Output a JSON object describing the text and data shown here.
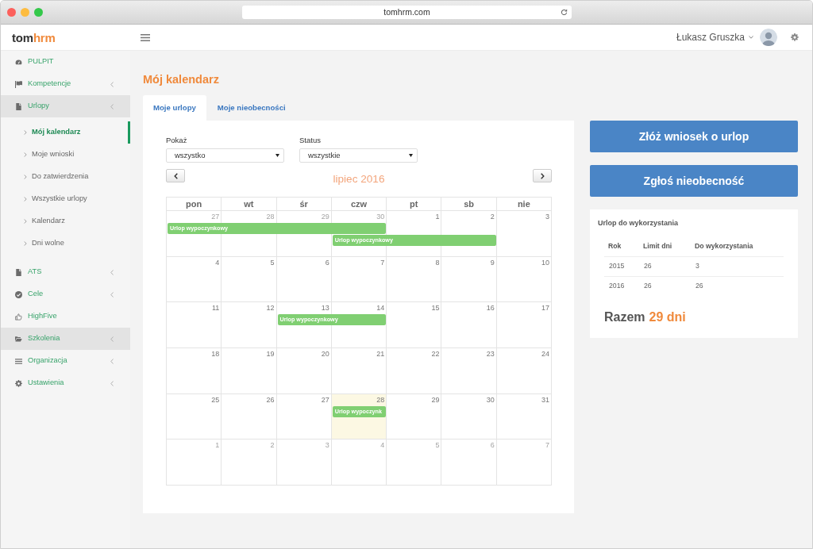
{
  "browser": {
    "url": "tomhrm.com"
  },
  "header": {
    "logo": {
      "part_1": "tom",
      "part_2": "hrm"
    },
    "user_name": "Łukasz Gruszka"
  },
  "sidebar": {
    "items": [
      {
        "label": "PULPIT",
        "kind": "link",
        "highlighted": false
      },
      {
        "label": "Kompetencje",
        "kind": "group",
        "highlighted": false
      },
      {
        "label": "Urlopy",
        "kind": "group",
        "highlighted": true,
        "children": [
          {
            "label": "Mój kalendarz",
            "selected": true
          },
          {
            "label": "Moje wnioski",
            "selected": false
          },
          {
            "label": "Do zatwierdzenia",
            "selected": false
          },
          {
            "label": "Wszystkie urlopy",
            "selected": false
          },
          {
            "label": "Kalendarz",
            "selected": false
          },
          {
            "label": "Dni wolne",
            "selected": false
          }
        ]
      },
      {
        "label": "ATS",
        "kind": "group",
        "highlighted": false
      },
      {
        "label": "Cele",
        "kind": "group",
        "highlighted": false
      },
      {
        "label": "HighFive",
        "kind": "link",
        "highlighted": false
      },
      {
        "label": "Szkolenia",
        "kind": "group",
        "highlighted": true
      },
      {
        "label": "Organizacja",
        "kind": "group",
        "highlighted": false
      },
      {
        "label": "Ustawienia",
        "kind": "group",
        "highlighted": false
      }
    ]
  },
  "page_title": "Mój kalendarz",
  "tabs": [
    {
      "label": "Moje urlopy",
      "selected": true
    },
    {
      "label": "Moje nieobecności",
      "selected": false
    }
  ],
  "filters": [
    {
      "label": "Pokaż",
      "value": "wszystko"
    },
    {
      "label": "Status",
      "value": "wszystkie"
    }
  ],
  "calendar": {
    "month_title": "lipiec 2016",
    "weekdays": [
      "pon",
      "wt",
      "śr",
      "czw",
      "pt",
      "sb",
      "nie"
    ],
    "weeks": [
      {
        "days": [
          {
            "day": "27",
            "other_month": true,
            "today": false
          },
          {
            "day": "28",
            "other_month": true,
            "today": false
          },
          {
            "day": "29",
            "other_month": true,
            "today": false
          },
          {
            "day": "30",
            "other_month": true,
            "today": false
          },
          {
            "day": "1",
            "other_month": false,
            "today": false
          },
          {
            "day": "2",
            "other_month": false,
            "today": false
          },
          {
            "day": "3",
            "other_month": false,
            "today": false
          }
        ],
        "events": [
          {
            "label": "Urlop wypoczynkowy",
            "days": [
              true,
              true,
              true,
              true,
              false,
              false,
              false
            ]
          },
          {
            "label": "Urlop wypoczynkowy",
            "days": [
              false,
              false,
              false,
              true,
              true,
              true,
              false
            ]
          }
        ]
      },
      {
        "days": [
          {
            "day": "4",
            "other_month": false,
            "today": false
          },
          {
            "day": "5",
            "other_month": false,
            "today": false
          },
          {
            "day": "6",
            "other_month": false,
            "today": false
          },
          {
            "day": "7",
            "other_month": false,
            "today": false
          },
          {
            "day": "8",
            "other_month": false,
            "today": false
          },
          {
            "day": "9",
            "other_month": false,
            "today": false
          },
          {
            "day": "10",
            "other_month": false,
            "today": false
          }
        ]
      },
      {
        "days": [
          {
            "day": "11",
            "other_month": false,
            "today": false
          },
          {
            "day": "12",
            "other_month": false,
            "today": false
          },
          {
            "day": "13",
            "other_month": false,
            "today": false
          },
          {
            "day": "14",
            "other_month": false,
            "today": false
          },
          {
            "day": "15",
            "other_month": false,
            "today": false
          },
          {
            "day": "16",
            "other_month": false,
            "today": false
          },
          {
            "day": "17",
            "other_month": false,
            "today": false
          }
        ],
        "events": [
          {
            "label": "Urlop wypoczynkowy",
            "days": [
              false,
              false,
              true,
              true,
              false,
              false,
              false
            ]
          }
        ]
      },
      {
        "days": [
          {
            "day": "18",
            "other_month": false,
            "today": false
          },
          {
            "day": "19",
            "other_month": false,
            "today": false
          },
          {
            "day": "20",
            "other_month": false,
            "today": false
          },
          {
            "day": "21",
            "other_month": false,
            "today": false
          },
          {
            "day": "22",
            "other_month": false,
            "today": false
          },
          {
            "day": "23",
            "other_month": false,
            "today": false
          },
          {
            "day": "24",
            "other_month": false,
            "today": false
          }
        ]
      },
      {
        "days": [
          {
            "day": "25",
            "other_month": false,
            "today": false
          },
          {
            "day": "26",
            "other_month": false,
            "today": false
          },
          {
            "day": "27",
            "other_month": false,
            "today": false
          },
          {
            "day": "28",
            "other_month": false,
            "today": true
          },
          {
            "day": "29",
            "other_month": false,
            "today": false
          },
          {
            "day": "30",
            "other_month": false,
            "today": false
          },
          {
            "day": "31",
            "other_month": false,
            "today": false
          }
        ],
        "events": [
          {
            "label": "Urlop wypoczynk",
            "days": [
              false,
              false,
              false,
              true,
              false,
              false,
              false
            ]
          }
        ]
      },
      {
        "days": [
          {
            "day": "1",
            "other_month": true,
            "today": false
          },
          {
            "day": "2",
            "other_month": true,
            "today": false
          },
          {
            "day": "3",
            "other_month": true,
            "today": false
          },
          {
            "day": "4",
            "other_month": true,
            "today": false
          },
          {
            "day": "5",
            "other_month": true,
            "today": false
          },
          {
            "day": "6",
            "other_month": true,
            "today": false
          },
          {
            "day": "7",
            "other_month": true,
            "today": false
          }
        ]
      }
    ]
  },
  "actions": [
    {
      "label": "Złóż wniosek o urlop"
    },
    {
      "label": "Zgłoś nieobecność"
    }
  ],
  "leave_balance": {
    "title": "Urlop do wykorzystania",
    "columns": [
      "Rok",
      "Limit dni",
      "Do wykorzystania"
    ],
    "rows": [
      [
        "2015",
        "26",
        "3"
      ],
      [
        "2016",
        "26",
        "26"
      ]
    ],
    "total": {
      "label": "Razem",
      "value": "29 dni"
    }
  }
}
